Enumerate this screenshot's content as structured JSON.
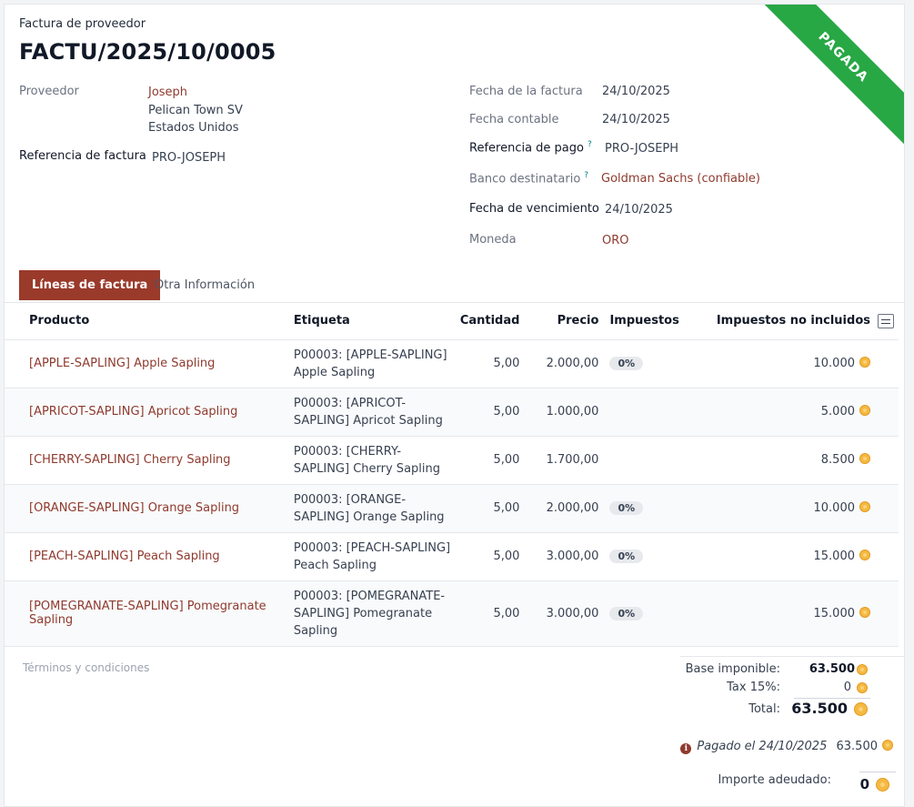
{
  "header": {
    "subtitle": "Factura de proveedor",
    "title": "FACTU/2025/10/0005",
    "status_ribbon": "PAGADA"
  },
  "left_fields": {
    "vendor_label": "Proveedor",
    "vendor_name": "Joseph",
    "vendor_address_1": "Pelican Town SV",
    "vendor_address_2": "Estados Unidos",
    "bill_ref_label": "Referencia de factura",
    "bill_ref_value": "PRO-JOSEPH"
  },
  "right_fields": {
    "invoice_date_label": "Fecha de la factura",
    "invoice_date_value": "24/10/2025",
    "accounting_date_label": "Fecha contable",
    "accounting_date_value": "24/10/2025",
    "payment_ref_label": "Referencia de pago",
    "payment_ref_help": "?",
    "payment_ref_value": "PRO-JOSEPH",
    "bank_label": "Banco destinatario",
    "bank_help": "?",
    "bank_value": "Goldman Sachs (confiable)",
    "due_date_label": "Fecha de vencimiento",
    "due_date_value": "24/10/2025",
    "currency_label": "Moneda",
    "currency_value": "ORO"
  },
  "tabs": {
    "lines": "Líneas de factura",
    "other": "Otra Información"
  },
  "table": {
    "headers": {
      "product": "Producto",
      "label": "Etiqueta",
      "quantity": "Cantidad",
      "price": "Precio",
      "taxes": "Impuestos",
      "subtotal": "Impuestos no incluidos"
    },
    "rows": [
      {
        "product": "[APPLE-SAPLING] Apple Sapling",
        "label": "P00003: [APPLE-SAPLING] Apple Sapling",
        "qty": "5,00",
        "price": "2.000,00",
        "tax": "0%",
        "subtotal": "10.000"
      },
      {
        "product": "[APRICOT-SAPLING] Apricot Sapling",
        "label": "P00003: [APRICOT-SAPLING] Apricot Sapling",
        "qty": "5,00",
        "price": "1.000,00",
        "tax": "",
        "subtotal": "5.000"
      },
      {
        "product": "[CHERRY-SAPLING] Cherry Sapling",
        "label": "P00003: [CHERRY-SAPLING] Cherry Sapling",
        "qty": "5,00",
        "price": "1.700,00",
        "tax": "",
        "subtotal": "8.500"
      },
      {
        "product": "[ORANGE-SAPLING] Orange Sapling",
        "label": "P00003: [ORANGE-SAPLING] Orange Sapling",
        "qty": "5,00",
        "price": "2.000,00",
        "tax": "0%",
        "subtotal": "10.000"
      },
      {
        "product": "[PEACH-SAPLING] Peach Sapling",
        "label": "P00003: [PEACH-SAPLING] Peach Sapling",
        "qty": "5,00",
        "price": "3.000,00",
        "tax": "0%",
        "subtotal": "15.000"
      },
      {
        "product": "[POMEGRANATE-SAPLING] Pomegranate Sapling",
        "label": "P00003: [POMEGRANATE-SAPLING] Pomegranate Sapling",
        "qty": "5,00",
        "price": "3.000,00",
        "tax": "0%",
        "subtotal": "15.000"
      }
    ]
  },
  "footer": {
    "terms_placeholder": "Términos y condiciones",
    "base_label": "Base imponible:",
    "base_value": "63.500",
    "tax_label": "Tax 15%:",
    "tax_value": "0",
    "total_label": "Total:",
    "total_value": "63.500",
    "paid_label": "Pagado el 24/10/2025",
    "paid_value": "63.500",
    "due_label": "Importe adeudado:",
    "due_value": "0"
  },
  "icons": {
    "currency": "gold-coin-icon",
    "info": "info-icon",
    "optional_columns": "optional-columns-icon"
  }
}
